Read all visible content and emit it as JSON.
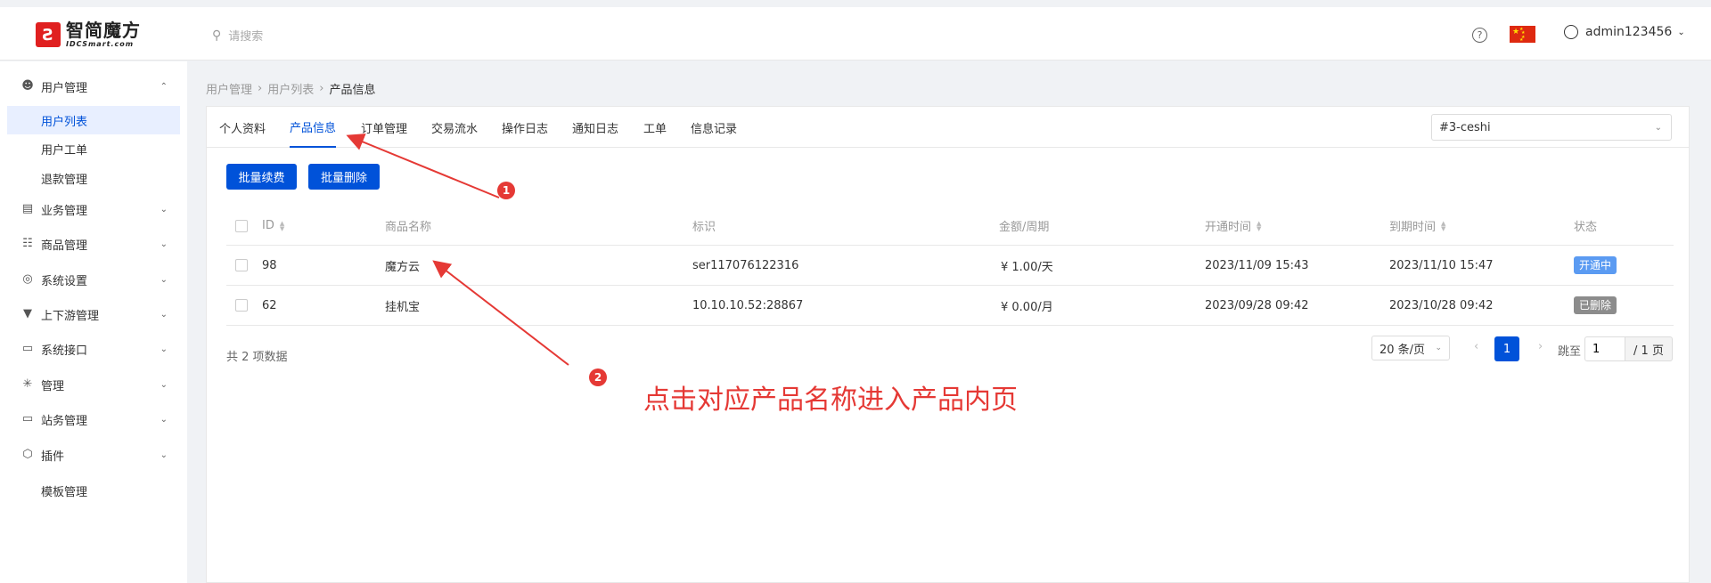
{
  "logo": {
    "mark": "Ƨ",
    "cn": "智简魔方",
    "en": "IDCSmart.com"
  },
  "search": {
    "placeholder": "请搜索"
  },
  "header": {
    "username": "admin123456"
  },
  "colors": {
    "primary": "#0052d9",
    "annotation": "#e53935",
    "active_badge": "#5b9bf2",
    "deleted_badge": "#8c8c8c"
  },
  "sidebar": {
    "groups": [
      {
        "label": "用户管理",
        "icon": "user-icon",
        "expanded": true
      },
      {
        "label": "业务管理",
        "icon": "list-icon"
      },
      {
        "label": "商品管理",
        "icon": "cart-icon"
      },
      {
        "label": "系统设置",
        "icon": "settings-icon"
      },
      {
        "label": "上下游管理",
        "icon": "filter-icon"
      },
      {
        "label": "系统接口",
        "icon": "folder-icon"
      },
      {
        "label": "管理",
        "icon": "loading-icon"
      },
      {
        "label": "站务管理",
        "icon": "folder-sync-icon"
      },
      {
        "label": "插件",
        "icon": "cube-icon"
      }
    ],
    "subitems": [
      "用户列表",
      "用户工单",
      "退款管理"
    ],
    "extra": "模板管理"
  },
  "breadcrumb": [
    "用户管理",
    "用户列表",
    "产品信息"
  ],
  "tabs": [
    "个人资料",
    "产品信息",
    "订单管理",
    "交易流水",
    "操作日志",
    "通知日志",
    "工单",
    "信息记录"
  ],
  "user_select": "#3-ceshi",
  "actions": {
    "renew": "批量续费",
    "delete": "批量删除"
  },
  "table": {
    "headers": [
      "ID",
      "商品名称",
      "标识",
      "金额/周期",
      "开通时间",
      "到期时间",
      "状态"
    ],
    "rows": [
      {
        "id": "98",
        "name": "魔方云",
        "ident": "ser117076122316",
        "amount": "¥ 1.00/天",
        "open": "2023/11/09 15:43",
        "expire": "2023/11/10 15:47",
        "status": "开通中"
      },
      {
        "id": "62",
        "name": "挂机宝",
        "ident": "10.10.10.52:28867",
        "amount": "¥ 0.00/月",
        "open": "2023/09/28 09:42",
        "expire": "2023/10/28 09:42",
        "status": "已删除"
      }
    ]
  },
  "pagination": {
    "total": "共 2 项数据",
    "page_size": "20 条/页",
    "current": "1",
    "jump_label": "跳至",
    "jump_value": "1",
    "total_pages": "/ 1 页"
  },
  "annotations": {
    "marker1": "1",
    "marker2": "2",
    "text": "点击对应产品名称进入产品内页"
  }
}
